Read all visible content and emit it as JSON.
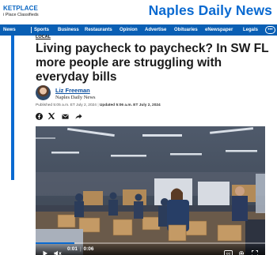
{
  "marketplace": {
    "title": "KETPLACE",
    "subtitle": "i Place Classifieds"
  },
  "brand": "Naples Daily News",
  "nav": {
    "items": [
      "News",
      "Sports",
      "Business",
      "Restaurants",
      "Opinion",
      "Advertise",
      "Obituaries",
      "eNewspaper",
      "Legals"
    ],
    "more_icon": "ellipsis-icon"
  },
  "article": {
    "section": "LOCAL",
    "headline": "Living paycheck to paycheck? In SW FL more people are struggling with everyday bills",
    "author": "Liz Freeman",
    "outlet": "Naples Daily News",
    "published": "Published 5:05 a.m. ET July 2, 2024",
    "updated": "Updated 5:06 a.m. ET July 2, 2024"
  },
  "share": {
    "icons": [
      "facebook-icon",
      "x-icon",
      "email-icon",
      "share-arrow-icon"
    ]
  },
  "video": {
    "current_time": "0:01",
    "duration": "0:06",
    "progress": 0.17,
    "controls": [
      "play-icon",
      "mute-icon",
      "captions-icon",
      "settings-icon",
      "fullscreen-icon"
    ]
  },
  "colors": {
    "brand_blue": "#0a6ad1",
    "nav_blue": "#0a5fb4",
    "author_link": "#0a4fa0"
  }
}
